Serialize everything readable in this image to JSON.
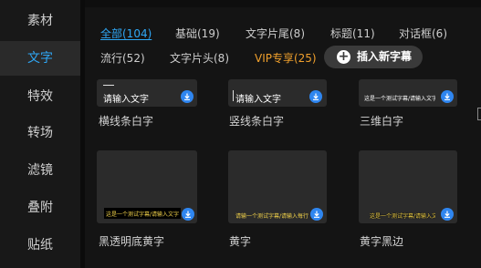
{
  "sidebar": {
    "items": [
      {
        "label": "素材"
      },
      {
        "label": "文字",
        "active": true
      },
      {
        "label": "特效"
      },
      {
        "label": "转场"
      },
      {
        "label": "滤镜"
      },
      {
        "label": "叠附"
      },
      {
        "label": "贴纸"
      }
    ]
  },
  "tabs": {
    "row1": [
      "全部(104)",
      "基础(19)",
      "文字片尾(8)",
      "标题(11)",
      "对话框(6)"
    ],
    "row2": [
      "流行(52)",
      "文字片头(8)",
      "VIP专享(25)"
    ]
  },
  "insert_button": {
    "label": "插入新字幕"
  },
  "cards": [
    {
      "preview": "请输入文字",
      "caption": "横线条白字"
    },
    {
      "preview": "请输入文字",
      "caption": "竖线条白字"
    },
    {
      "preview": "这是一个测试字幕/请输入文字/这里是测试",
      "caption": "三维白字"
    },
    {
      "preview": "这是一个测试字幕/请输入文字/这里是测试",
      "caption": "黑透明底黄字"
    },
    {
      "preview": "请输一个测试字幕/请输入每行字数限制",
      "caption": "黄字"
    },
    {
      "preview": "这是一个测试字幕/请输入文字/这里",
      "caption": "黄字黑边"
    }
  ],
  "colors": {
    "accent": "#2fa7f5",
    "vip": "#f0a02c",
    "download": "#2f86f0",
    "subtitle_yellow": "#f2d24a"
  },
  "icons": {
    "download": "download-icon",
    "insert": "plus-circle-icon"
  }
}
